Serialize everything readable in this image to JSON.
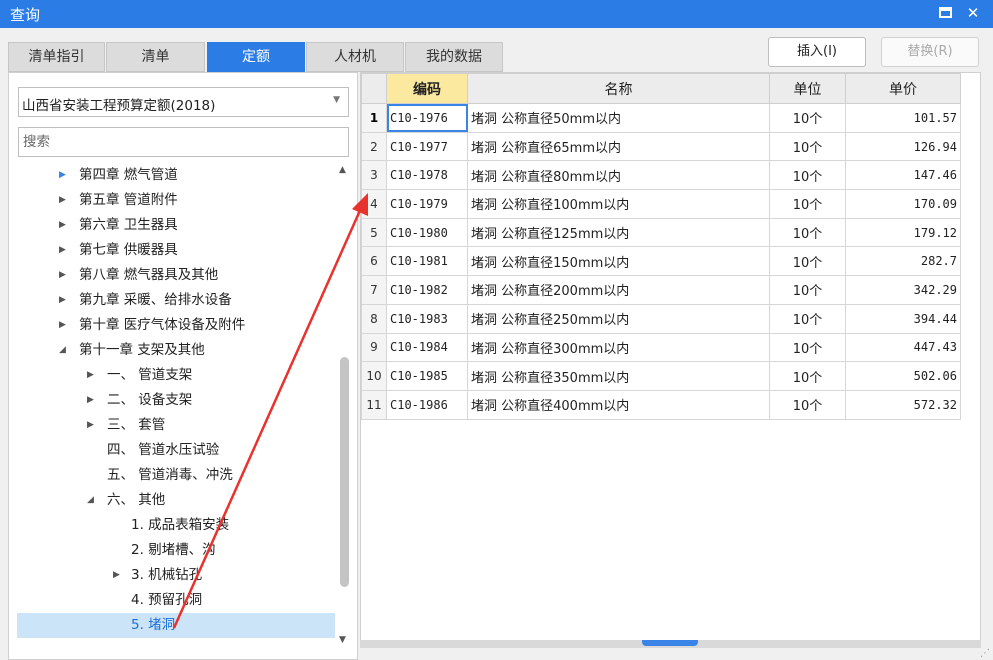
{
  "window": {
    "title": "查询"
  },
  "tabs": [
    {
      "label": "清单指引",
      "active": false
    },
    {
      "label": "清单",
      "active": false
    },
    {
      "label": "定额",
      "active": true
    },
    {
      "label": "人材机",
      "active": false
    },
    {
      "label": "我的数据",
      "active": false
    }
  ],
  "toolbar": {
    "insert_label": "插入(I)",
    "replace_label": "替换(R)"
  },
  "left": {
    "select_value": "山西省安装工程预算定额(2018)",
    "search_placeholder": "搜索",
    "tree": [
      {
        "label": "第四章 燃气管道",
        "expander": "collapsed"
      },
      {
        "label": "第五章 管道附件",
        "expander": "collapsed"
      },
      {
        "label": "第六章 卫生器具",
        "expander": "collapsed"
      },
      {
        "label": "第七章 供暖器具",
        "expander": "collapsed"
      },
      {
        "label": "第八章 燃气器具及其他",
        "expander": "collapsed"
      },
      {
        "label": "第九章 采暖、给排水设备",
        "expander": "collapsed"
      },
      {
        "label": "第十章 医疗气体设备及附件",
        "expander": "collapsed"
      },
      {
        "label": "第十一章 支架及其他",
        "expander": "expanded"
      },
      {
        "label": "一、 管道支架",
        "expander": "collapsed"
      },
      {
        "label": "二、 设备支架",
        "expander": "collapsed"
      },
      {
        "label": "三、 套管",
        "expander": "collapsed"
      },
      {
        "label": "四、 管道水压试验",
        "expander": "none"
      },
      {
        "label": "五、 管道消毒、冲洗",
        "expander": "none"
      },
      {
        "label": "六、 其他",
        "expander": "expanded"
      },
      {
        "label": "1. 成品表箱安装",
        "expander": "none"
      },
      {
        "label": "2. 剔堵槽、沟",
        "expander": "none"
      },
      {
        "label": "3. 机械钻孔",
        "expander": "collapsed"
      },
      {
        "label": "4. 预留孔洞",
        "expander": "none"
      },
      {
        "label": "5. 堵洞",
        "expander": "none",
        "selected": true
      }
    ]
  },
  "grid": {
    "columns": [
      "编码",
      "名称",
      "单位",
      "单价"
    ],
    "rows": [
      {
        "no": "1",
        "code": "C10-1976",
        "name": "堵洞 公称直径50mm以内",
        "unit": "10个",
        "price": "101.57"
      },
      {
        "no": "2",
        "code": "C10-1977",
        "name": "堵洞 公称直径65mm以内",
        "unit": "10个",
        "price": "126.94"
      },
      {
        "no": "3",
        "code": "C10-1978",
        "name": "堵洞 公称直径80mm以内",
        "unit": "10个",
        "price": "147.46"
      },
      {
        "no": "4",
        "code": "C10-1979",
        "name": "堵洞 公称直径100mm以内",
        "unit": "10个",
        "price": "170.09"
      },
      {
        "no": "5",
        "code": "C10-1980",
        "name": "堵洞 公称直径125mm以内",
        "unit": "10个",
        "price": "179.12"
      },
      {
        "no": "6",
        "code": "C10-1981",
        "name": "堵洞 公称直径150mm以内",
        "unit": "10个",
        "price": "282.7"
      },
      {
        "no": "7",
        "code": "C10-1982",
        "name": "堵洞 公称直径200mm以内",
        "unit": "10个",
        "price": "342.29"
      },
      {
        "no": "8",
        "code": "C10-1983",
        "name": "堵洞 公称直径250mm以内",
        "unit": "10个",
        "price": "394.44"
      },
      {
        "no": "9",
        "code": "C10-1984",
        "name": "堵洞 公称直径300mm以内",
        "unit": "10个",
        "price": "447.43"
      },
      {
        "no": "10",
        "code": "C10-1985",
        "name": "堵洞 公称直径350mm以内",
        "unit": "10个",
        "price": "502.06"
      },
      {
        "no": "11",
        "code": "C10-1986",
        "name": "堵洞 公称直径400mm以内",
        "unit": "10个",
        "price": "572.32"
      }
    ]
  },
  "colors": {
    "accent": "#2b7ce4",
    "highlight_header": "#fbe9a0",
    "selected_row": "#cce4f7",
    "annotation_arrow": "#e8322e"
  },
  "icons": {
    "maximize": "maximize-icon",
    "close": "close-icon",
    "collapsed": "triangle-right-icon",
    "expanded": "triangle-down-icon",
    "dropdown": "chevron-down-icon"
  }
}
